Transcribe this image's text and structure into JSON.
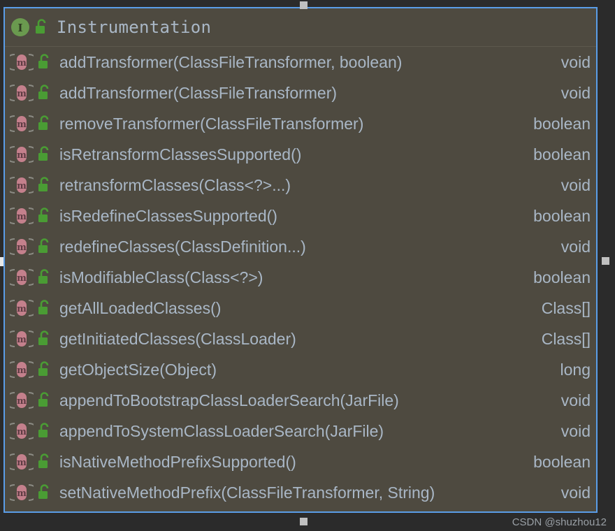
{
  "panel": {
    "header": {
      "icon": "interface-icon",
      "visibility_icon": "unlocked-padlock-icon",
      "title": "Instrumentation"
    },
    "members": [
      {
        "icon": "method-icon",
        "visibility_icon": "unlocked-padlock-icon",
        "signature": "addTransformer(ClassFileTransformer, boolean)",
        "return_type": "void"
      },
      {
        "icon": "method-icon",
        "visibility_icon": "unlocked-padlock-icon",
        "signature": "addTransformer(ClassFileTransformer)",
        "return_type": "void"
      },
      {
        "icon": "method-icon",
        "visibility_icon": "unlocked-padlock-icon",
        "signature": "removeTransformer(ClassFileTransformer)",
        "return_type": "boolean"
      },
      {
        "icon": "method-icon",
        "visibility_icon": "unlocked-padlock-icon",
        "signature": "isRetransformClassesSupported()",
        "return_type": "boolean"
      },
      {
        "icon": "method-icon",
        "visibility_icon": "unlocked-padlock-icon",
        "signature": "retransformClasses(Class<?>...)",
        "return_type": "void"
      },
      {
        "icon": "method-icon",
        "visibility_icon": "unlocked-padlock-icon",
        "signature": "isRedefineClassesSupported()",
        "return_type": "boolean"
      },
      {
        "icon": "method-icon",
        "visibility_icon": "unlocked-padlock-icon",
        "signature": "redefineClasses(ClassDefinition...)",
        "return_type": "void"
      },
      {
        "icon": "method-icon",
        "visibility_icon": "unlocked-padlock-icon",
        "signature": "isModifiableClass(Class<?>)",
        "return_type": "boolean"
      },
      {
        "icon": "method-icon",
        "visibility_icon": "unlocked-padlock-icon",
        "signature": "getAllLoadedClasses()",
        "return_type": "Class[]"
      },
      {
        "icon": "method-icon",
        "visibility_icon": "unlocked-padlock-icon",
        "signature": "getInitiatedClasses(ClassLoader)",
        "return_type": "Class[]"
      },
      {
        "icon": "method-icon",
        "visibility_icon": "unlocked-padlock-icon",
        "signature": "getObjectSize(Object)",
        "return_type": "long"
      },
      {
        "icon": "method-icon",
        "visibility_icon": "unlocked-padlock-icon",
        "signature": "appendToBootstrapClassLoaderSearch(JarFile)",
        "return_type": "void"
      },
      {
        "icon": "method-icon",
        "visibility_icon": "unlocked-padlock-icon",
        "signature": "appendToSystemClassLoaderSearch(JarFile)",
        "return_type": "void"
      },
      {
        "icon": "method-icon",
        "visibility_icon": "unlocked-padlock-icon",
        "signature": "isNativeMethodPrefixSupported()",
        "return_type": "boolean"
      },
      {
        "icon": "method-icon",
        "visibility_icon": "unlocked-padlock-icon",
        "signature": "setNativeMethodPrefix(ClassFileTransformer, String)",
        "return_type": "void"
      }
    ]
  },
  "handles": {
    "top": "resize-handle-top",
    "bottom": "resize-handle-bottom",
    "left": "resize-handle-left",
    "right": "resize-handle-right"
  },
  "watermark": "CSDN @shuzhou12",
  "colors": {
    "outer_background": "#2b2b2b",
    "panel_background": "#4e4a40",
    "panel_border": "#5a9de8",
    "text": "#a9b7c6",
    "interface_icon": "#6a9a4f",
    "method_icon": "#c4808c",
    "lock_icon": "#4a9c34",
    "handle": "#c0c0c0",
    "watermark_text": "#9aa0a6"
  }
}
